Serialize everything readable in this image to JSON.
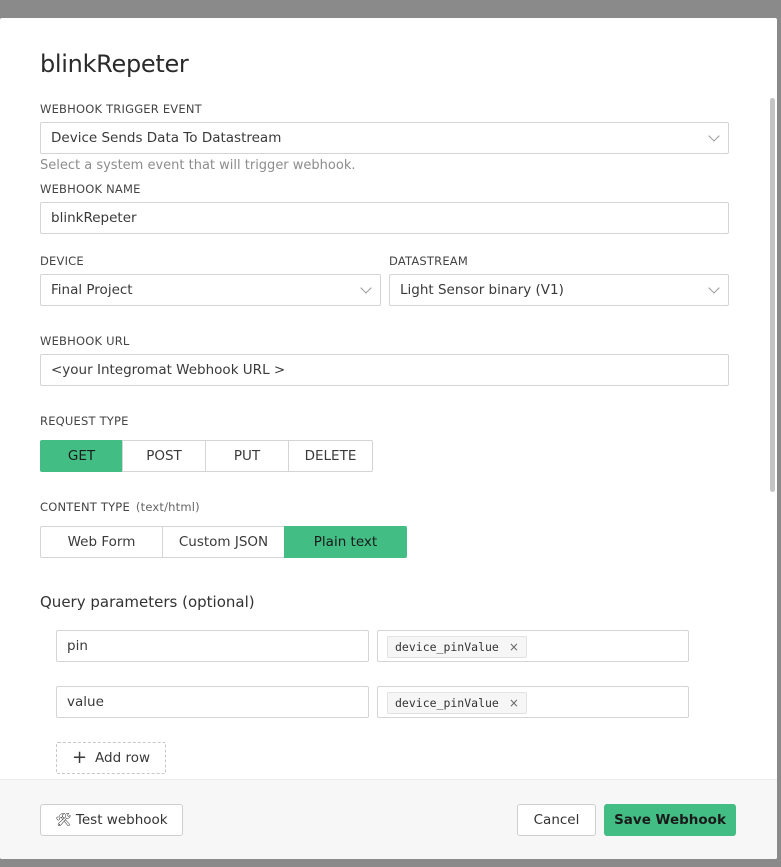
{
  "modal": {
    "title": "blinkRepeter"
  },
  "trigger_event": {
    "label": "WEBHOOK TRIGGER EVENT",
    "value": "Device Sends Data To Datastream",
    "hint": "Select a system event that will trigger webhook."
  },
  "webhook_name": {
    "label": "WEBHOOK NAME",
    "value": "blinkRepeter"
  },
  "device": {
    "label": "DEVICE",
    "value": "Final Project"
  },
  "datastream": {
    "label": "DATASTREAM",
    "value": "Light Sensor binary (V1)"
  },
  "webhook_url": {
    "label": "WEBHOOK URL",
    "value": "<your Integromat Webhook URL >"
  },
  "request_type": {
    "label": "REQUEST TYPE",
    "options": [
      "GET",
      "POST",
      "PUT",
      "DELETE"
    ],
    "selected": "GET"
  },
  "content_type": {
    "label": "CONTENT TYPE",
    "sub": "(text/html)",
    "options": [
      "Web Form",
      "Custom JSON",
      "Plain text"
    ],
    "selected": "Plain text"
  },
  "query_params": {
    "title": "Query parameters (optional)",
    "rows": [
      {
        "key": "pin",
        "value_tag": "device_pinValue",
        "remove": "×"
      },
      {
        "key": "value",
        "value_tag": "device_pinValue",
        "remove": "×"
      }
    ],
    "add_row_label": "Add row",
    "add_row_icon": "+"
  },
  "footer": {
    "test_label": "Test webhook",
    "test_icon": "🛠",
    "cancel_label": "Cancel",
    "save_label": "Save Webhook"
  },
  "colors": {
    "accent": "#42bd84",
    "backdrop": "#8a8a8a"
  }
}
